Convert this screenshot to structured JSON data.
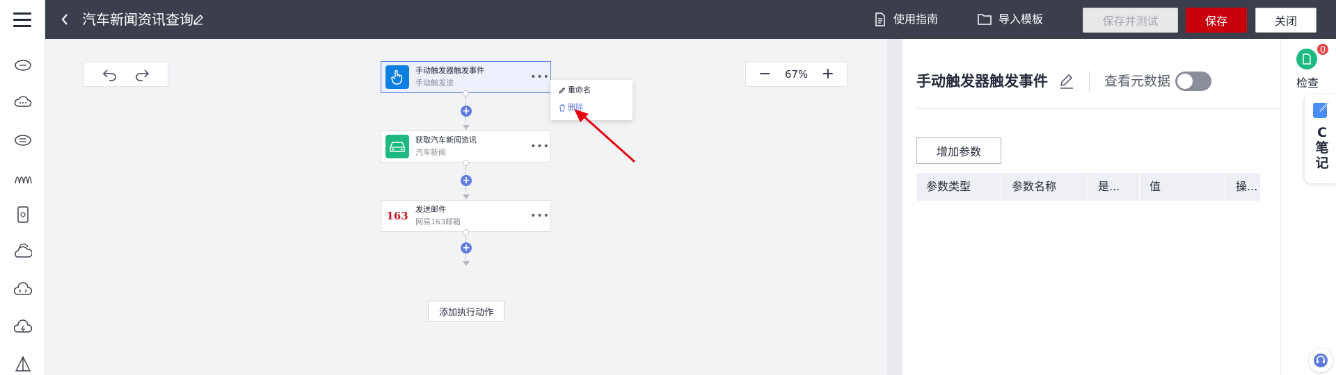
{
  "header": {
    "title": "汽车新闻资讯查询",
    "guide_label": "使用指南",
    "import_label": "导入模板",
    "save_test_label": "保存并测试",
    "save_label": "保存",
    "close_label": "关闭"
  },
  "canvas": {
    "zoom": "67%",
    "nodes": [
      {
        "title": "手动触发器触发事件",
        "subtitle": "手动触发流"
      },
      {
        "title": "获取汽车新闻资讯",
        "subtitle": "汽车新闻"
      },
      {
        "title": "发送邮件",
        "subtitle": "网易163邮箱",
        "icon_text": "163"
      }
    ],
    "context_menu": {
      "rename": "重命名",
      "delete": "删除"
    },
    "add_action_label": "添加执行动作"
  },
  "panel": {
    "title": "手动触发器触发事件",
    "metadata_label": "查看元数据",
    "add_param_label": "增加参数",
    "columns": [
      "参数类型",
      "参数名称",
      "是...",
      "值",
      "操..."
    ]
  },
  "rightbar": {
    "check_label": "检查",
    "badge_count": "0",
    "note_letter": "C",
    "note_chars": [
      "笔",
      "记"
    ]
  },
  "colors": {
    "topbar": "#3b3f4b",
    "save": "#c7000b",
    "accent": "#5e7ce0",
    "green": "#1eb980"
  }
}
